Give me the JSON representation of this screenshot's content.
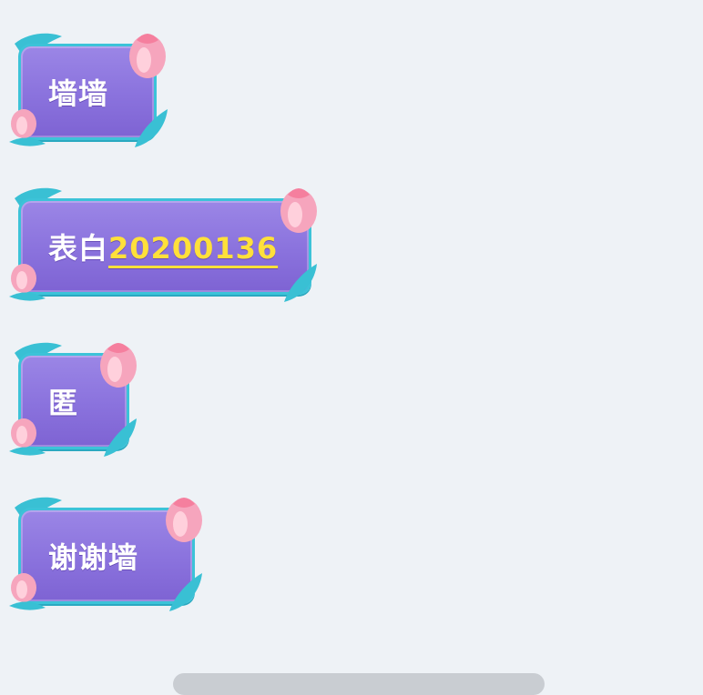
{
  "messages": [
    {
      "text": "墙墙"
    },
    {
      "prefix": "表白",
      "link": "20200136"
    },
    {
      "text": "匿"
    },
    {
      "text": "谢谢墙"
    }
  ],
  "colors": {
    "background": "#eef2f6",
    "bubble": "#8a72dd",
    "border": "#3cc3d8",
    "text": "#ffffff",
    "link": "#ffe03a",
    "flower": "#f7a9c0"
  },
  "icons": [
    "tulip-icon",
    "leaf-icon"
  ]
}
